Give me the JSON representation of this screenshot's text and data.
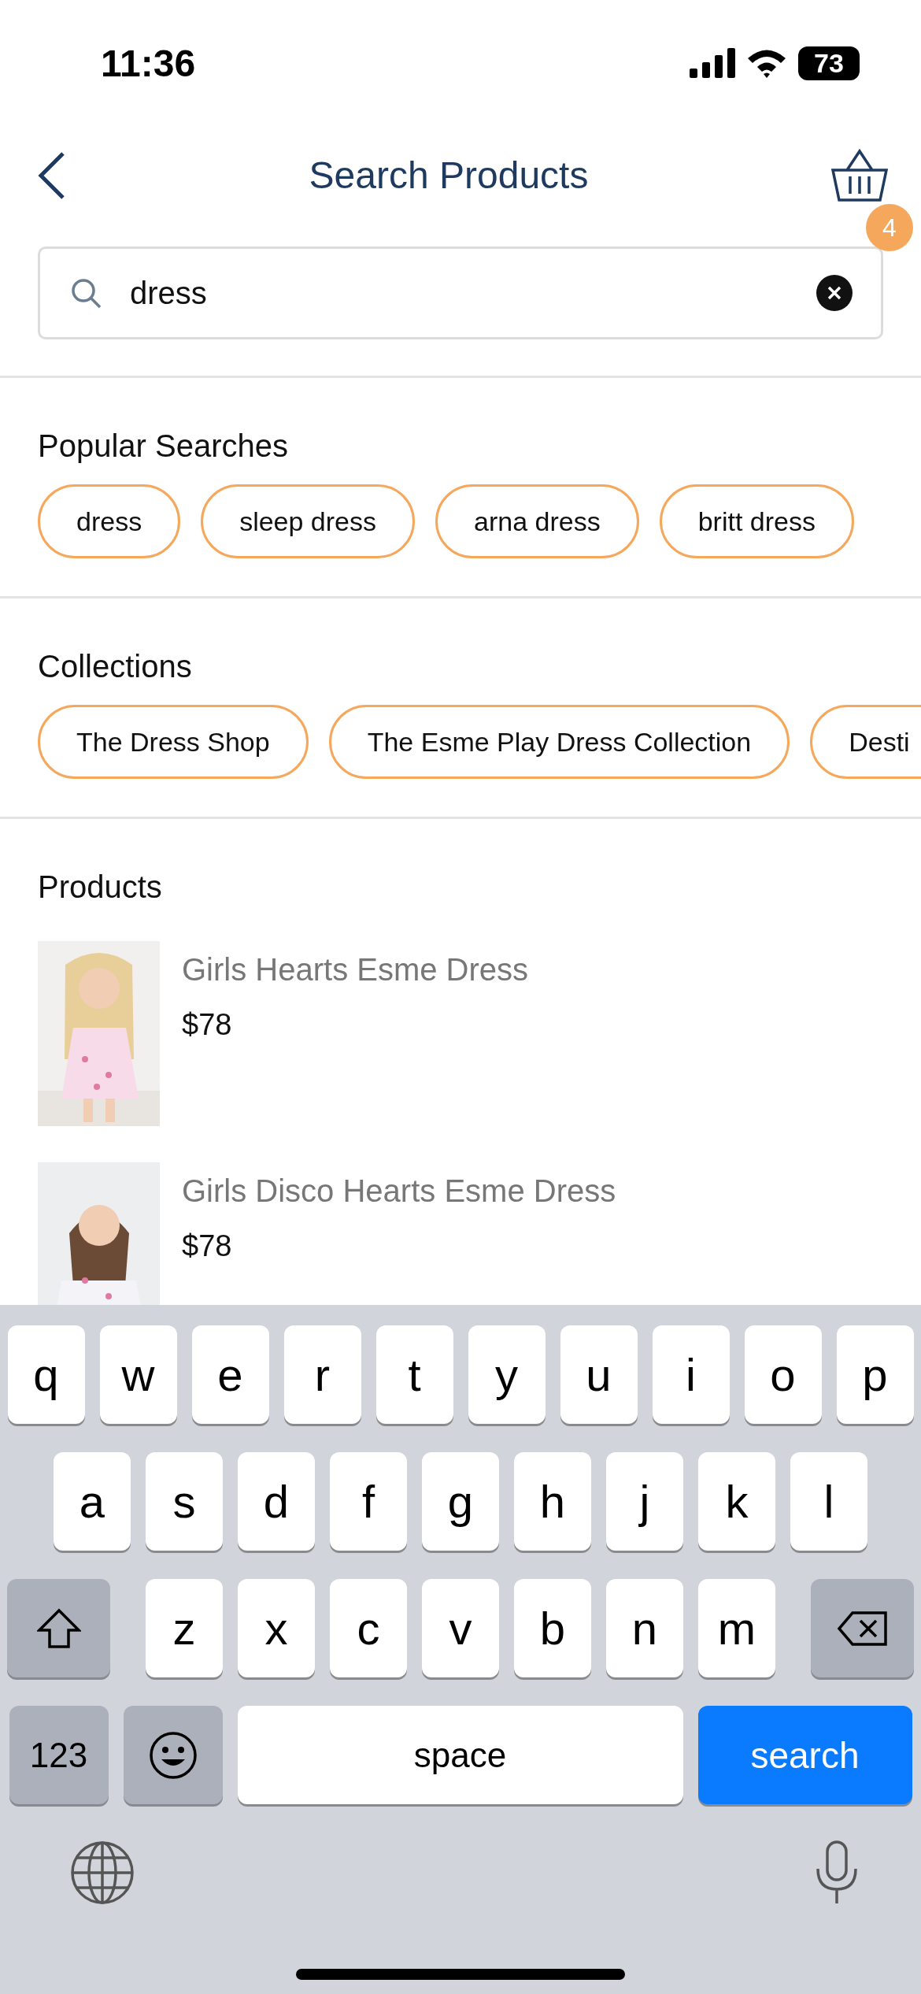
{
  "status_bar": {
    "time": "11:36",
    "battery": "73"
  },
  "header": {
    "title": "Search Products",
    "cart_count": "4"
  },
  "search": {
    "value": "dress"
  },
  "popular_searches": {
    "title": "Popular Searches",
    "items": [
      "dress",
      "sleep dress",
      "arna dress",
      "britt dress"
    ]
  },
  "collections": {
    "title": "Collections",
    "items": [
      "The Dress Shop",
      "The Esme Play Dress Collection",
      "Desti"
    ]
  },
  "products": {
    "title": "Products",
    "items": [
      {
        "name": "Girls Hearts Esme Dress",
        "price": "$78"
      },
      {
        "name": "Girls Disco Hearts Esme Dress",
        "price": "$78"
      }
    ]
  },
  "keyboard": {
    "rows": [
      [
        "q",
        "w",
        "e",
        "r",
        "t",
        "y",
        "u",
        "i",
        "o",
        "p"
      ],
      [
        "a",
        "s",
        "d",
        "f",
        "g",
        "h",
        "j",
        "k",
        "l"
      ],
      [
        "z",
        "x",
        "c",
        "v",
        "b",
        "n",
        "m"
      ]
    ],
    "numbers_key": "123",
    "space_key": "space",
    "search_key": "search"
  }
}
